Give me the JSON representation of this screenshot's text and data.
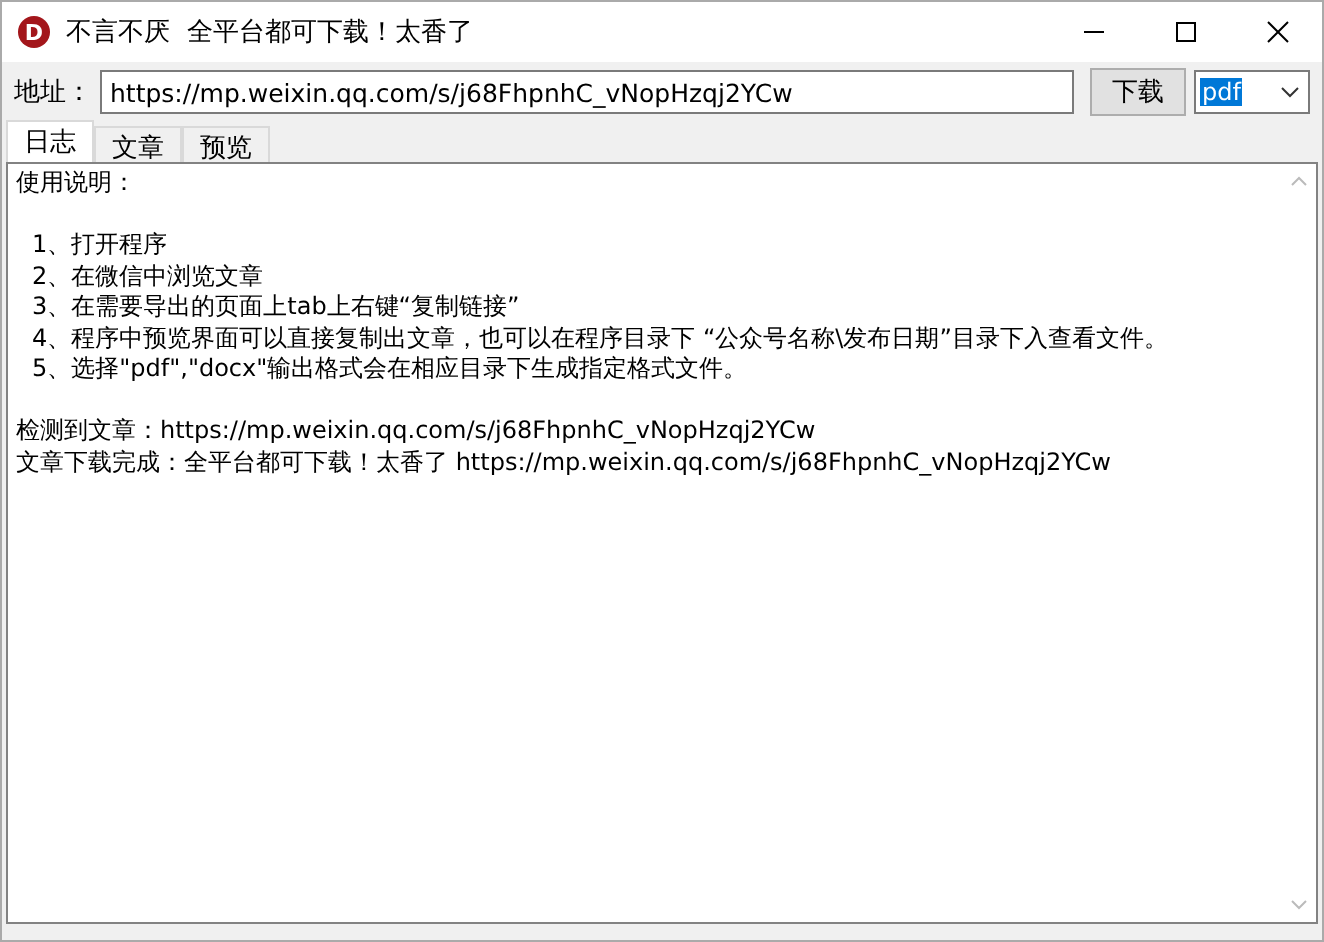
{
  "window": {
    "logo_letter": "D",
    "title": "不言不厌  全平台都可下载！太香了"
  },
  "address_bar": {
    "label": "地址：",
    "value": "https://mp.weixin.qq.com/s/j68FhpnhC_vNopHzqj2YCw",
    "button": "下载",
    "format": {
      "value": "pdf",
      "highlighted": true
    }
  },
  "tabs": [
    {
      "label": "日志",
      "selected": true
    },
    {
      "label": "文章",
      "selected": false
    },
    {
      "label": "预览",
      "selected": false
    }
  ],
  "log": [
    {
      "kind": "heading",
      "lines": [
        "使用说明："
      ]
    },
    {
      "kind": "steps",
      "lines": [
        "1、打开程序",
        "2、在微信中浏览文章",
        "3、在需要导出的页面上tab上右键“复制链接”",
        "4、程序中预览界面可以直接复制出文章，也可以在程序目录下 “公众号名称\\发布日期”目录下入查看文件。",
        "5、选择\"pdf\",\"docx\"输出格式会在相应目录下生成指定格式文件。"
      ]
    },
    {
      "kind": "output",
      "lines": [
        "检测到文章：https://mp.weixin.qq.com/s/j68FhpnhC_vNopHzqj2YCw",
        "文章下载完成：全平台都可下载！太香了  https://mp.weixin.qq.com/s/j68FhpnhC_vNopHzqj2YCw"
      ]
    }
  ]
}
